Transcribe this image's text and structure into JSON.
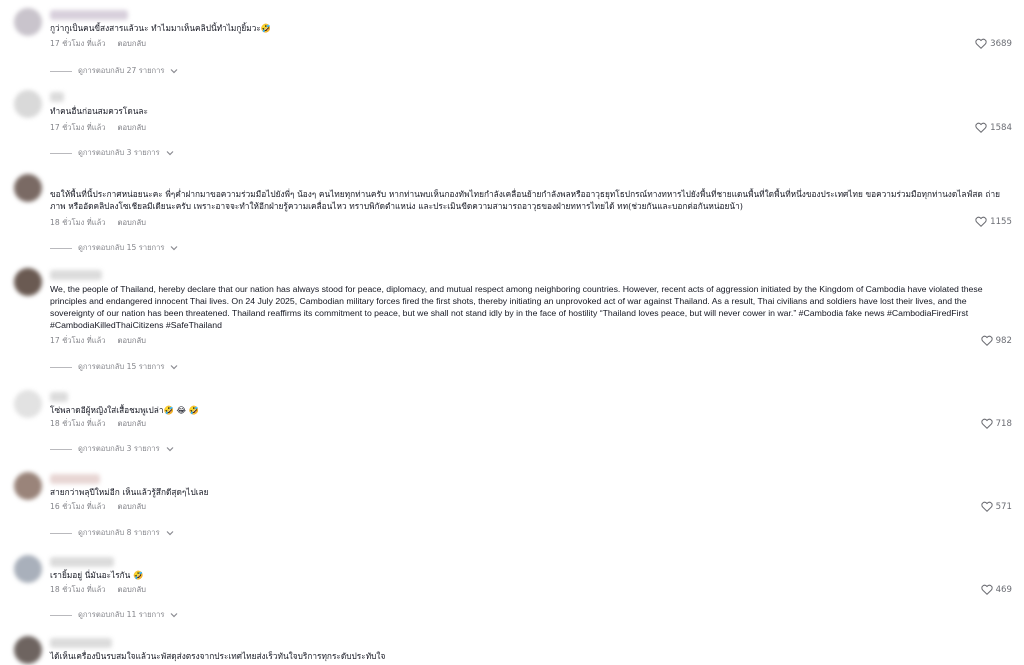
{
  "colors": {
    "text": "#161823",
    "meta": "#8a8b91",
    "heart": "#6b6c72"
  },
  "icons": {
    "like": "heart-outline-icon",
    "expand": "chevron-down-icon"
  },
  "comments": [
    {
      "text": "กูว่ากูเป็นคนขี้สงสารแล้วนะ ทำไมมาเห็นคลิปนี้ทำไมกูยิ้มวะ🤣",
      "time": "17 ชั่วโมง ที่แล้ว",
      "reply_label": "ตอบกลับ",
      "likes": "3689",
      "replies_label": "ดูการตอบกลับ 27 รายการ"
    },
    {
      "text": "ทำคนอื่นก่อนสมควรโดนละ",
      "time": "17 ชั่วโมง ที่แล้ว",
      "reply_label": "ตอบกลับ",
      "likes": "1584",
      "replies_label": "ดูการตอบกลับ 3 รายการ"
    },
    {
      "text": "ขอให้พื้นที่นี้ประกาศหน่อยนะคะ พี่ๆค่ำฝากมาขอความร่วมมือไปยังพี่ๆ น้องๆ คนไทยทุกท่านครับ หากท่านพบเห็นกองทัพไทยกำลังเคลื่อนย้ายกำลังพลหรืออาวุธยุทโธปกรณ์ทางทหารไปยังพื้นที่ชายแดนพื้นที่ใดพื้นที่หนึ่งของประเทศไทย ขอความร่วมมือทุกท่านงดไลฟ์สด ถ่ายภาพ หรืออัดคลิปลงโซเชียลมีเดียนะครับ เพราะอาจจะทำให้อีกฝ่ายรู้ความเคลื่อนไหว ทราบพิกัดตำแหน่ง และประเมินขีดความสามารถอาวุธของฝ่ายทหารไทยได้ ทท(ช่วยกันและบอกต่อกันหน่อยน้า)",
      "time": "18 ชั่วโมง ที่แล้ว",
      "reply_label": "ตอบกลับ",
      "likes": "1155",
      "replies_label": "ดูการตอบกลับ 15 รายการ"
    },
    {
      "text": "We, the people of Thailand, hereby declare that our nation has always stood for peace, diplomacy, and mutual respect among neighboring countries. However, recent acts of aggression initiated by the Kingdom of Cambodia have violated these principles and endangered innocent Thai lives. On 24 July 2025, Cambodian military forces fired the first shots, thereby initiating an unprovoked act of war against Thailand. As a result, Thai civilians and soldiers have lost their lives, and the sovereignty of our nation has been threatened. Thailand reaffirms its commitment to peace, but we shall not stand idly by in the face of hostility “Thailand loves peace, but will never cower in war.” #Cambodia fake news #CambodiaFiredFirst #CambodiaKilledThaiCitizens #SafeThailand",
      "time": "17 ชั่วโมง ที่แล้ว",
      "reply_label": "ตอบกลับ",
      "likes": "982",
      "replies_label": "ดูการตอบกลับ 15 รายการ"
    },
    {
      "text": "โซ่พลาดอีผู้หญิงใส่เสื้อชมพูเปล่า🤣 😂 🤣",
      "time": "18 ชั่วโมง ที่แล้ว",
      "reply_label": "ตอบกลับ",
      "likes": "718",
      "replies_label": "ดูการตอบกลับ 3 รายการ"
    },
    {
      "text": "สายกว่าพลุปีใหม่อีก เห็นแล้วรู้สึกดีสุดๆไปเลย",
      "time": "16 ชั่วโมง ที่แล้ว",
      "reply_label": "ตอบกลับ",
      "likes": "571",
      "replies_label": "ดูการตอบกลับ 8 รายการ"
    },
    {
      "text": "เรายิ้มอยู่ นี่มันอะไรกัน 🤣",
      "time": "18 ชั่วโมง ที่แล้ว",
      "reply_label": "ตอบกลับ",
      "likes": "469",
      "replies_label": "ดูการตอบกลับ 11 รายการ"
    },
    {
      "text": "ได้เห็นเครื่องบินรบสมใจแล้วนะพัสดุส่งตรงจากประเทศไทยส่งเร็วทันใจบริการทุกระดับประทับใจ"
    }
  ]
}
